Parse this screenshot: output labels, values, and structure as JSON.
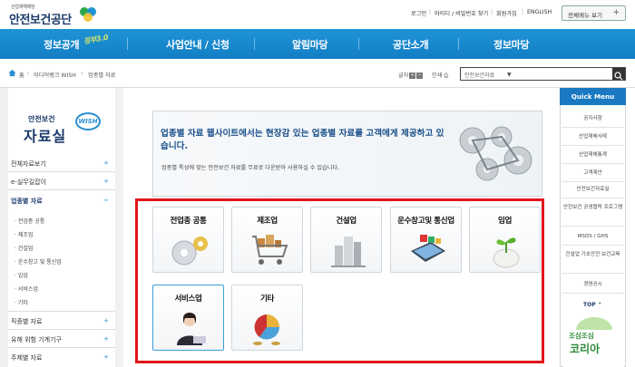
{
  "header": {
    "logo_sub": "산업재해예방",
    "logo_main": "안전보건공단",
    "util_links": [
      "로그인",
      "아이디 / 비밀번호 찾기",
      "회원가입",
      "ENGLISH"
    ],
    "all_menu_label": "전체메뉴 보기"
  },
  "gnb": {
    "tag": "정부3.0",
    "items": [
      "정보공개",
      "사업안내 / 신청",
      "알림마당",
      "공단소개",
      "정보마당"
    ]
  },
  "breadcrumb": {
    "items": [
      "홈",
      "미디어뱅크 WISH",
      "업종별 자료"
    ]
  },
  "tools": {
    "font_label": "글자",
    "print_label": "인쇄",
    "search_placeholder": "안전보건자료"
  },
  "lnb": {
    "title_small": "안전보건",
    "title_large": "자료실",
    "wish": "WISH",
    "items": [
      "전체자료보기",
      "e-실무길잡이",
      "업종별 자료",
      "직종별 자료",
      "유해 위험 기계기구",
      "주제별 자료"
    ],
    "sub_items": [
      "전업종 공통",
      "제조업",
      "건설업",
      "운수창고 및 통신업",
      "임업",
      "서비스업",
      "기타"
    ]
  },
  "banner": {
    "headline": "업종별 자료 웹사이트에서는 현장감 있는 업종별 자료를 고객에게 제공하고 있습니다.",
    "description": "업종별 특성에 맞는 안전보건 자료를 무료로 다운받아 사용하실 수 있습니다."
  },
  "categories": [
    {
      "label": "전업종 공통"
    },
    {
      "label": "제조업"
    },
    {
      "label": "건설업"
    },
    {
      "label": "운수창고및 통신업"
    },
    {
      "label": "임업"
    },
    {
      "label": "서비스업"
    },
    {
      "label": "기타"
    }
  ],
  "quick_menu": {
    "title": "Quick Menu",
    "items": [
      "공지사항",
      "산업재해사례",
      "산업재해통계",
      "고객제안",
      "안전보건자료실",
      "안전보건 공생협력 프로그램",
      "MSDS / GHS",
      "건설업 기초안전 보건교육",
      "경영공시"
    ],
    "top_label": "TOP",
    "banner_line1": "조심조심",
    "banner_line2": "코리아"
  },
  "colors": {
    "nav_blue": "#127ec4",
    "highlight_red": "#e3141a",
    "quick_head": "#1a79c2"
  }
}
